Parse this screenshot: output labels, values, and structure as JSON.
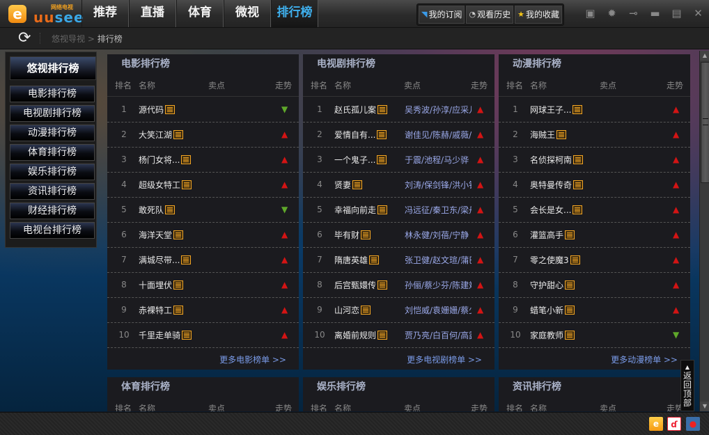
{
  "app": {
    "logo_letter": "e",
    "logo_text_uu": "uu",
    "logo_text_see": "see",
    "logo_subtitle": "网络电视"
  },
  "nav": {
    "tabs": [
      {
        "label": "推荐",
        "active": false
      },
      {
        "label": "直播",
        "active": false
      },
      {
        "label": "体育",
        "active": false
      },
      {
        "label": "微视",
        "active": false
      },
      {
        "label": "排行榜",
        "active": true
      }
    ]
  },
  "toolbar": {
    "subscribe_icon": "rss-icon",
    "subscribe_label": "我的订阅",
    "history_icon": "history-icon",
    "history_label": "观看历史",
    "favorites_icon": "star-icon",
    "favorites_label": "我的收藏"
  },
  "window_controls": [
    "dropdown-icon",
    "gear-icon",
    "pin-icon",
    "minimize-icon",
    "maximize-icon",
    "close-icon"
  ],
  "breadcrumb": {
    "root": "悠视导视",
    "separator": ">",
    "current": "排行榜"
  },
  "sidebar": {
    "title": "悠视排行榜",
    "items": [
      "电影排行榜",
      "电视剧排行榜",
      "动漫排行榜",
      "体育排行榜",
      "娱乐排行榜",
      "资讯排行榜",
      "财经排行榜",
      "电视台排行榜"
    ]
  },
  "columns": {
    "rank": "排名",
    "name": "名称",
    "highlight": "卖点",
    "trend": "走势"
  },
  "colors": {
    "trend_up": "#d21414",
    "trend_down": "#5fa82a",
    "accent": "#3fb0ee",
    "link": "#7a9be8",
    "news_icon": "#f5a623"
  },
  "panels": [
    {
      "title": "电影排行榜",
      "more": "更多电影榜单  >>",
      "rows": [
        {
          "rank": "1",
          "name": "源代码",
          "highlight": "",
          "trend": "down"
        },
        {
          "rank": "2",
          "name": "大笑江湖",
          "highlight": "",
          "trend": "up"
        },
        {
          "rank": "3",
          "name": "杨门女将...",
          "highlight": "",
          "trend": "up"
        },
        {
          "rank": "4",
          "name": "超级女特工",
          "highlight": "",
          "trend": "up"
        },
        {
          "rank": "5",
          "name": "敢死队",
          "highlight": "",
          "trend": "down"
        },
        {
          "rank": "6",
          "name": "海洋天堂",
          "highlight": "",
          "trend": "up"
        },
        {
          "rank": "7",
          "name": "满城尽带...",
          "highlight": "",
          "trend": "up"
        },
        {
          "rank": "8",
          "name": "十面埋伏",
          "highlight": "",
          "trend": "up"
        },
        {
          "rank": "9",
          "name": "赤裸特工",
          "highlight": "",
          "trend": "up"
        },
        {
          "rank": "10",
          "name": "千里走单骑",
          "highlight": "",
          "trend": "up"
        }
      ]
    },
    {
      "title": "电视剧排行榜",
      "more": "更多电视剧榜单  >>",
      "rows": [
        {
          "rank": "1",
          "name": "赵氏孤儿案",
          "highlight": "吴秀波/孙淳/应采儿",
          "trend": "up"
        },
        {
          "rank": "2",
          "name": "爱情自有...",
          "highlight": "谢佳见/陈赫/戚薇/",
          "trend": "up"
        },
        {
          "rank": "3",
          "name": "一个鬼子...",
          "highlight": "于震/池程/马少骅",
          "trend": "up"
        },
        {
          "rank": "4",
          "name": "贤妻",
          "highlight": "刘涛/保剑锋/洪小铃",
          "trend": "up"
        },
        {
          "rank": "5",
          "name": "幸福向前走",
          "highlight": "冯远征/秦卫东/梁丹",
          "trend": "up"
        },
        {
          "rank": "6",
          "name": "毕有财",
          "highlight": "林永健/刘蓓/宁静",
          "trend": "up"
        },
        {
          "rank": "7",
          "name": "隋唐英雄",
          "highlight": "张卫健/赵文瑄/蒲巴",
          "trend": "up"
        },
        {
          "rank": "8",
          "name": "后宫甄嬛传",
          "highlight": "孙俪/蔡少芬/陈建斌",
          "trend": "up"
        },
        {
          "rank": "9",
          "name": "山河恋",
          "highlight": "刘恺威/袁姗姗/蔡少",
          "trend": "up"
        },
        {
          "rank": "10",
          "name": "离婚前规则",
          "highlight": "贾乃亮/白百何/高露",
          "trend": "up"
        }
      ]
    },
    {
      "title": "动漫排行榜",
      "more": "更多动漫榜单  >>",
      "rows": [
        {
          "rank": "1",
          "name": "网球王子...",
          "highlight": "",
          "trend": "up"
        },
        {
          "rank": "2",
          "name": "海贼王",
          "highlight": "",
          "trend": "up"
        },
        {
          "rank": "3",
          "name": "名侦探柯南",
          "highlight": "",
          "trend": "up"
        },
        {
          "rank": "4",
          "name": "奥特曼传奇",
          "highlight": "",
          "trend": "up"
        },
        {
          "rank": "5",
          "name": "会长是女...",
          "highlight": "",
          "trend": "up"
        },
        {
          "rank": "6",
          "name": "灌篮高手",
          "highlight": "",
          "trend": "up"
        },
        {
          "rank": "7",
          "name": "零之使魔3",
          "highlight": "",
          "trend": "up"
        },
        {
          "rank": "8",
          "name": "守护甜心",
          "highlight": "",
          "trend": "up"
        },
        {
          "rank": "9",
          "name": "蜡笔小新",
          "highlight": "",
          "trend": "up"
        },
        {
          "rank": "10",
          "name": "家庭教师",
          "highlight": "",
          "trend": "down"
        }
      ]
    }
  ],
  "panels_second_row": [
    {
      "title": "体育排行榜"
    },
    {
      "title": "娱乐排行榜"
    },
    {
      "title": "资讯排行榜"
    }
  ],
  "back_to_top": {
    "arrow": "▲",
    "label": "返回顶部"
  },
  "status_icons": [
    "uusee-bag-icon",
    "flash-icon",
    "joystick-icon"
  ]
}
